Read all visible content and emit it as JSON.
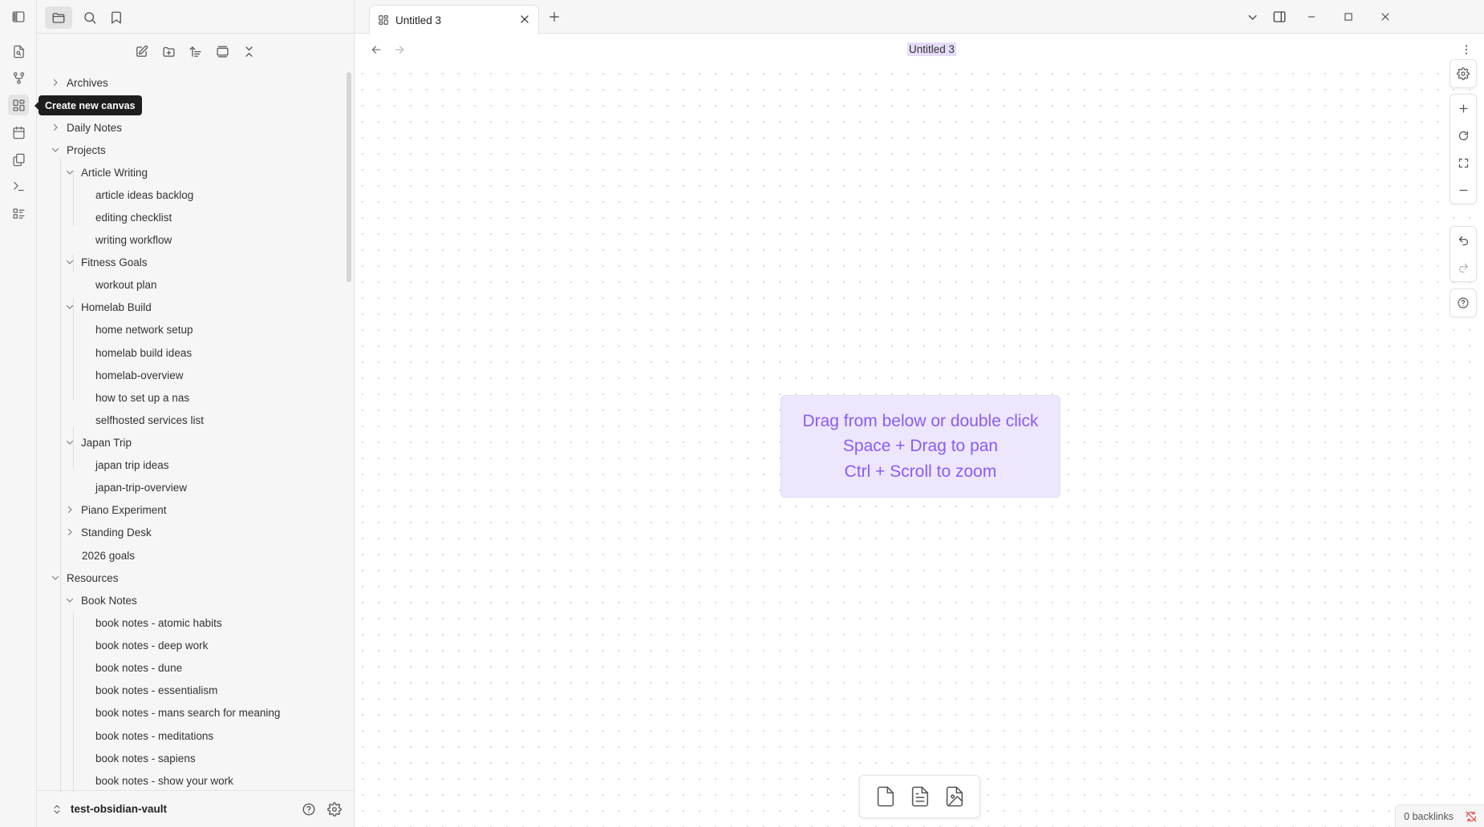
{
  "colors": {
    "accent": "#8a5cf6",
    "accent_bg": "#ede6fc",
    "sync_error": "#e5484d"
  },
  "ribbon": {
    "items": [
      {
        "name": "open-quick-switcher",
        "icon": "file-search-icon"
      },
      {
        "name": "graph-view",
        "icon": "git-fork-icon"
      },
      {
        "name": "create-new-canvas",
        "icon": "layout-dashboard-icon",
        "active": true
      },
      {
        "name": "daily-notes",
        "icon": "calendar-icon"
      },
      {
        "name": "templates",
        "icon": "files-icon"
      },
      {
        "name": "command-palette",
        "icon": "terminal-icon"
      },
      {
        "name": "outline",
        "icon": "list-checks-icon"
      }
    ],
    "tooltip": "Create new canvas"
  },
  "sidebar": {
    "top_tabs": [
      "files-icon",
      "search-icon",
      "bookmark-icon"
    ],
    "nav_actions": [
      "new-note-icon",
      "new-folder-icon",
      "sort-icon",
      "auto-reveal-icon",
      "collapse-all-icon"
    ],
    "tree": [
      {
        "label": "Archives",
        "level": 0,
        "type": "folder",
        "expanded": false
      },
      {
        "label": "Daily Notes",
        "level": 0,
        "type": "folder",
        "expanded": false
      },
      {
        "label": "Projects",
        "level": 0,
        "type": "folder",
        "expanded": true
      },
      {
        "label": "Article Writing",
        "level": 1,
        "type": "folder",
        "expanded": true
      },
      {
        "label": "article ideas backlog",
        "level": 2,
        "type": "file"
      },
      {
        "label": "editing checklist",
        "level": 2,
        "type": "file"
      },
      {
        "label": "writing workflow",
        "level": 2,
        "type": "file"
      },
      {
        "label": "Fitness Goals",
        "level": 1,
        "type": "folder",
        "expanded": true
      },
      {
        "label": "workout plan",
        "level": 2,
        "type": "file"
      },
      {
        "label": "Homelab Build",
        "level": 1,
        "type": "folder",
        "expanded": true
      },
      {
        "label": "home network setup",
        "level": 2,
        "type": "file"
      },
      {
        "label": "homelab build ideas",
        "level": 2,
        "type": "file"
      },
      {
        "label": "homelab-overview",
        "level": 2,
        "type": "file"
      },
      {
        "label": "how to set up a nas",
        "level": 2,
        "type": "file"
      },
      {
        "label": "selfhosted services list",
        "level": 2,
        "type": "file"
      },
      {
        "label": "Japan Trip",
        "level": 1,
        "type": "folder",
        "expanded": true
      },
      {
        "label": "japan trip ideas",
        "level": 2,
        "type": "file"
      },
      {
        "label": "japan-trip-overview",
        "level": 2,
        "type": "file"
      },
      {
        "label": "Piano Experiment",
        "level": 1,
        "type": "folder",
        "expanded": false
      },
      {
        "label": "Standing Desk",
        "level": 1,
        "type": "folder",
        "expanded": false
      },
      {
        "label": "2026 goals",
        "level": 1,
        "type": "file"
      },
      {
        "label": "Resources",
        "level": 0,
        "type": "folder",
        "expanded": true
      },
      {
        "label": "Book Notes",
        "level": 1,
        "type": "folder",
        "expanded": true
      },
      {
        "label": "book notes - atomic habits",
        "level": 2,
        "type": "file"
      },
      {
        "label": "book notes - deep work",
        "level": 2,
        "type": "file"
      },
      {
        "label": "book notes - dune",
        "level": 2,
        "type": "file"
      },
      {
        "label": "book notes - essentialism",
        "level": 2,
        "type": "file"
      },
      {
        "label": "book notes - mans search for meaning",
        "level": 2,
        "type": "file"
      },
      {
        "label": "book notes - meditations",
        "level": 2,
        "type": "file"
      },
      {
        "label": "book notes - sapiens",
        "level": 2,
        "type": "file"
      },
      {
        "label": "book notes - show your work",
        "level": 2,
        "type": "file"
      }
    ],
    "vault_name": "test-obsidian-vault"
  },
  "tabs": [
    {
      "label": "Untitled 3",
      "icon": "canvas-icon",
      "active": true
    }
  ],
  "view": {
    "title": "Untitled 3"
  },
  "canvas": {
    "placeholder_lines": [
      "Drag from below or double click",
      "Space + Drag to pan",
      "Ctrl + Scroll to zoom"
    ],
    "controls": {
      "settings": [
        "settings-icon"
      ],
      "zoom": [
        "zoom-in-icon",
        "reset-zoom-icon",
        "zoom-to-fit-icon",
        "zoom-out-icon"
      ],
      "history": [
        "undo-icon",
        "redo-icon"
      ],
      "help": [
        "help-icon"
      ]
    },
    "card_tray": [
      "add-card-icon",
      "add-note-icon",
      "add-media-icon"
    ]
  },
  "status_bar": {
    "backlinks": "0 backlinks"
  }
}
